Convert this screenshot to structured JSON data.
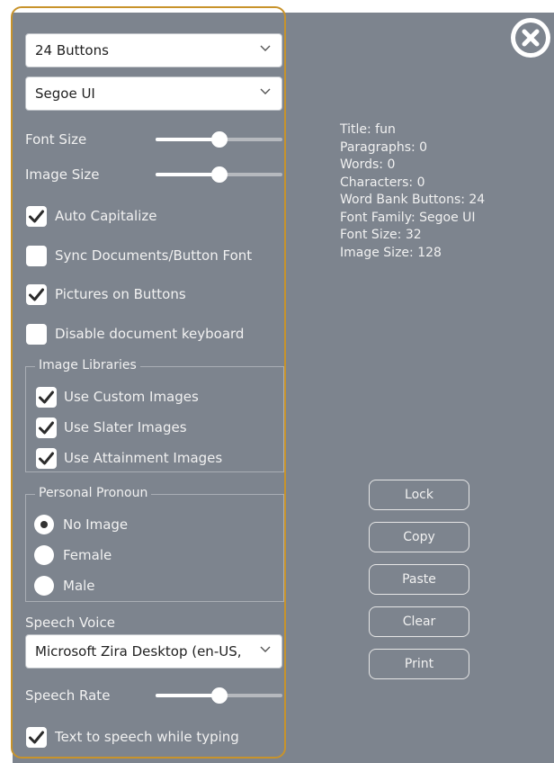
{
  "settings": {
    "button_count_select": "24 Buttons",
    "font_select": "Segoe UI",
    "font_size": {
      "label": "Font Size",
      "value_fraction": 0.5
    },
    "image_size": {
      "label": "Image Size",
      "value_fraction": 0.5
    },
    "auto_capitalize": {
      "label": "Auto Capitalize",
      "checked": true
    },
    "sync_font": {
      "label": "Sync Documents/Button Font",
      "checked": false
    },
    "pictures_on_buttons": {
      "label": "Pictures on Buttons",
      "checked": true
    },
    "disable_keyboard": {
      "label": "Disable document keyboard",
      "checked": false
    },
    "image_libraries": {
      "legend": "Image Libraries",
      "custom": {
        "label": "Use Custom Images",
        "checked": true
      },
      "slater": {
        "label": "Use Slater Images",
        "checked": true
      },
      "attainment": {
        "label": "Use Attainment Images",
        "checked": true
      }
    },
    "personal_pronoun": {
      "legend": "Personal Pronoun",
      "options": [
        "No Image",
        "Female",
        "Male"
      ],
      "selected": "No Image"
    },
    "speech_voice": {
      "label": "Speech Voice",
      "value": "Microsoft Zira Desktop (en-US,"
    },
    "speech_rate": {
      "label": "Speech Rate",
      "value_fraction": 0.5
    },
    "tts_typing": {
      "label": "Text to speech while typing",
      "checked": true
    }
  },
  "info": {
    "title": "Title: fun",
    "paragraphs": "Paragraphs: 0",
    "words": "Words: 0",
    "characters": "Characters: 0",
    "word_bank": "Word Bank Buttons: 24",
    "font_family": "Font Family: Segoe UI",
    "font_size": "Font Size: 32",
    "image_size": "Image Size: 128"
  },
  "actions": {
    "lock": "Lock",
    "copy": "Copy",
    "paste": "Paste",
    "clear": "Clear",
    "print": "Print"
  },
  "icons": {
    "close": "close-icon",
    "checkbox": "checkmark-icon",
    "dropdown": "chevron-down-icon"
  },
  "colors": {
    "panel": "#7d848e",
    "highlight": "#c8932b"
  }
}
